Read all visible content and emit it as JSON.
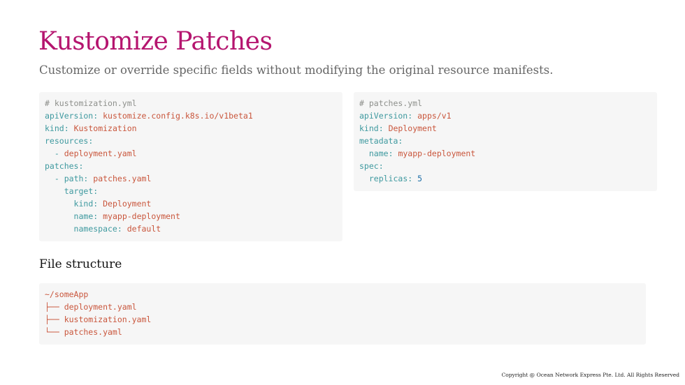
{
  "slide": {
    "title": "Kustomize Patches",
    "subtitle": "Customize or override specific fields without modifying the original resource manifests.",
    "section_heading": "File structure",
    "copyright": "Copyright @ Ocean Network Express Pte. Ltd. All Rights Reserved"
  },
  "colors": {
    "title": "#b5156f",
    "comment": "#8e908c",
    "key": "#3e999f",
    "string": "#c9563c",
    "number": "#1e6fa8",
    "code_background": "#f6f6f6"
  },
  "code": {
    "kustomization": {
      "comment": "# kustomization.yml",
      "lines": [
        {
          "indent": "",
          "key": "apiVersion",
          "value": "kustomize.config.k8s.io/v1beta1"
        },
        {
          "indent": "",
          "key": "kind",
          "value": "Kustomization"
        },
        {
          "indent": "",
          "key": "resources",
          "value": ""
        },
        {
          "indent": "  ",
          "dash": "- ",
          "value": "deployment.yaml"
        },
        {
          "indent": "",
          "key": "patches",
          "value": ""
        },
        {
          "indent": "  ",
          "dash": "- ",
          "key": "path",
          "value": "patches.yaml"
        },
        {
          "indent": "    ",
          "key": "target",
          "value": ""
        },
        {
          "indent": "      ",
          "key": "kind",
          "value": "Deployment"
        },
        {
          "indent": "      ",
          "key": "name",
          "value": "myapp-deployment"
        },
        {
          "indent": "      ",
          "key": "namespace",
          "value": "default"
        }
      ]
    },
    "patches": {
      "comment": "# patches.yml",
      "lines": [
        {
          "indent": "",
          "key": "apiVersion",
          "value": "apps/v1"
        },
        {
          "indent": "",
          "key": "kind",
          "value": "Deployment"
        },
        {
          "indent": "",
          "key": "metadata",
          "value": ""
        },
        {
          "indent": "  ",
          "key": "name",
          "value": "myapp-deployment"
        },
        {
          "indent": "",
          "key": "spec",
          "value": ""
        },
        {
          "indent": "  ",
          "key": "replicas",
          "value": "5",
          "numeric": true
        }
      ]
    },
    "file_tree": {
      "lines": [
        "~/someApp",
        "├── deployment.yaml",
        "├── kustomization.yaml",
        "└── patches.yaml"
      ]
    }
  }
}
